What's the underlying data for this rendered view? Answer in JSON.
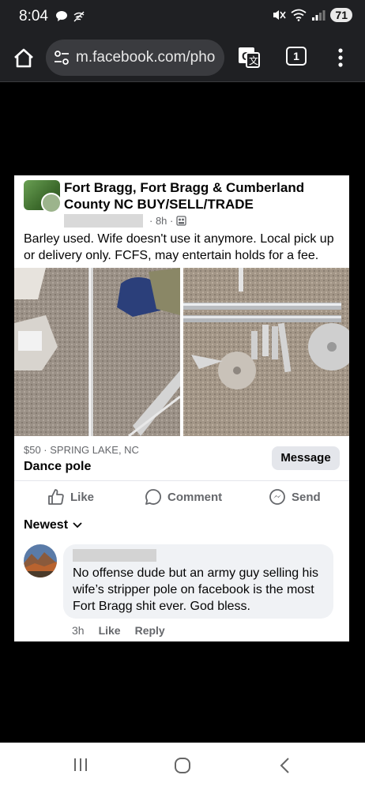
{
  "status_bar": {
    "time": "8:04",
    "battery": "71",
    "icons": [
      "chat-bubble-icon",
      "wifi-off-icon",
      "mute-icon",
      "wifi-icon",
      "signal-icon"
    ]
  },
  "browser": {
    "url": "m.facebook.com/pho",
    "tab_count": "1"
  },
  "post": {
    "group_name": "Fort Bragg, Fort Bragg & Cumberland County NC BUY/SELL/TRADE",
    "time": "· 8h ·",
    "text": "Barley used. Wife doesn't use it anymore. Local pick up or delivery only. FCFS, may entertain holds for a fee.",
    "price_location": "$50 · SPRING LAKE, NC",
    "item_title": "Dance pole",
    "message_label": "Message"
  },
  "actions": {
    "like": "Like",
    "comment": "Comment",
    "send": "Send"
  },
  "comments": {
    "sort_label": "Newest",
    "items": [
      {
        "text": "No offense dude but an army guy selling his wife’s stripper pole on facebook is the most Fort Bragg shit ever. God bless.",
        "time": "3h",
        "like": "Like",
        "reply": "Reply"
      }
    ]
  },
  "colors": {
    "facebook_text": "#050505",
    "secondary_text": "#65676b",
    "bubble_bg": "#f0f2f5",
    "button_bg": "#e4e6eb"
  }
}
